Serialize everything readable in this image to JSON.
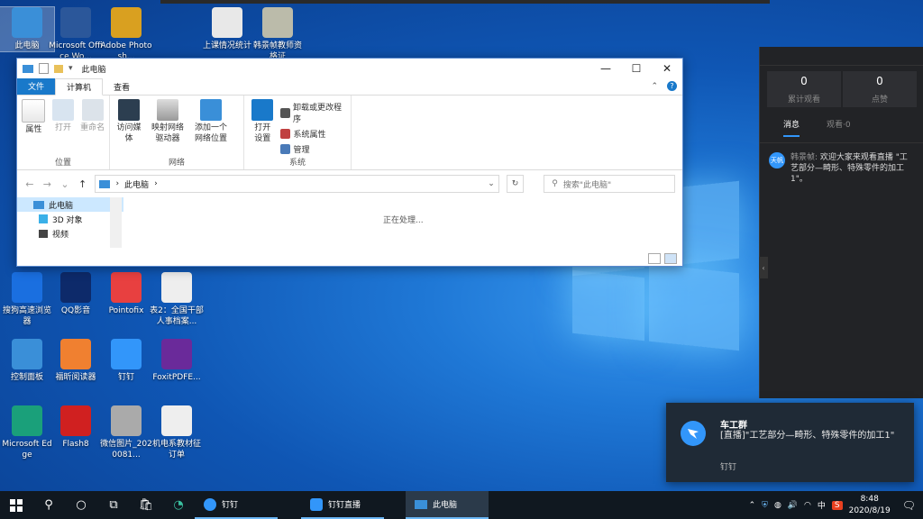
{
  "desktop": {
    "icons": [
      {
        "label": "此电脑",
        "icon": "computer-icon",
        "color": "#3a8fd8"
      },
      {
        "label": "Microsoft Office Wo...",
        "icon": "word-icon",
        "color": "#2b579a"
      },
      {
        "label": "Adobe Photosh...",
        "icon": "photoshop-icon",
        "color": "#d9a020"
      },
      {
        "label": "上课情况统计",
        "icon": "excel-file-icon",
        "color": "#e8e8e8"
      },
      {
        "label": "韩景帧教师资格证",
        "icon": "image-file-icon",
        "color": "#bba"
      },
      {
        "label": "搜狗高速浏览器",
        "icon": "sogou-browser-icon",
        "color": "#1a6fe0"
      },
      {
        "label": "QQ影音",
        "icon": "qq-player-icon",
        "color": "#0d2a6a"
      },
      {
        "label": "Pointofix",
        "icon": "pointofix-icon",
        "color": "#e84040"
      },
      {
        "label": "表2：全国干部人事档案...",
        "icon": "word-file-icon",
        "color": "#eeeeee"
      },
      {
        "label": "控制面板",
        "icon": "control-panel-icon",
        "color": "#3a8fd8"
      },
      {
        "label": "福昕阅读器",
        "icon": "foxit-reader-icon",
        "color": "#f08030"
      },
      {
        "label": "钉钉",
        "icon": "dingtalk-icon",
        "color": "#3296fa"
      },
      {
        "label": "FoxitPDFE...",
        "icon": "foxit-editor-icon",
        "color": "#6a2a9a"
      },
      {
        "label": "Microsoft Edge",
        "icon": "edge-icon",
        "color": "#1aa07a"
      },
      {
        "label": "Flash8",
        "icon": "flash-icon",
        "color": "#d02020"
      },
      {
        "label": "微信图片_2020081...",
        "icon": "image-file-icon",
        "color": "#aaa"
      },
      {
        "label": "机电系教材征订单",
        "icon": "excel-file-icon",
        "color": "#eeeeee"
      }
    ]
  },
  "explorer": {
    "title": "此电脑",
    "tabs": {
      "file": "文件",
      "computer": "计算机",
      "view": "查看"
    },
    "ribbon": {
      "location": {
        "name": "位置",
        "properties": "属性",
        "open": "打开",
        "rename": "重命名"
      },
      "network": {
        "name": "网络",
        "media": "访问媒体",
        "map_drive_1": "映射网络",
        "map_drive_2": "驱动器",
        "add_location_1": "添加一个",
        "add_location_2": "网络位置"
      },
      "system": {
        "name": "系统",
        "open_settings_1": "打开",
        "open_settings_2": "设置",
        "uninstall": "卸载或更改程序",
        "system_props": "系统属性",
        "manage": "管理"
      }
    },
    "address": {
      "path": "此电脑",
      "arrow": "›"
    },
    "search": {
      "placeholder": "搜索\"此电脑\""
    },
    "nav": {
      "this_pc": "此电脑",
      "objects3d": "3D 对象",
      "videos": "视频"
    },
    "status": "正在处理..."
  },
  "live_panel": {
    "stats": [
      {
        "value": "0",
        "label": "累计观看"
      },
      {
        "value": "0",
        "label": "点赞"
      }
    ],
    "tabs": {
      "messages": "消息",
      "viewers": "观看·0"
    },
    "message": {
      "avatar": "天帆",
      "sender": "韩景帧:",
      "text": "欢迎大家来观看直播 \"工艺部分—畸形、特殊零件的加工1\"。"
    }
  },
  "notification": {
    "title": "车工群",
    "body": "[直播]\"工艺部分—畸形、特殊零件的加工1\"",
    "app": "钉钉"
  },
  "taskbar": {
    "apps": [
      {
        "label": "钉钉"
      },
      {
        "label": "钉钉直播"
      },
      {
        "label": "此电脑"
      }
    ],
    "tray": {
      "ime_cn": "中",
      "ime_s": "S"
    },
    "clock": {
      "time": "8:48",
      "date": "2020/8/19"
    }
  }
}
